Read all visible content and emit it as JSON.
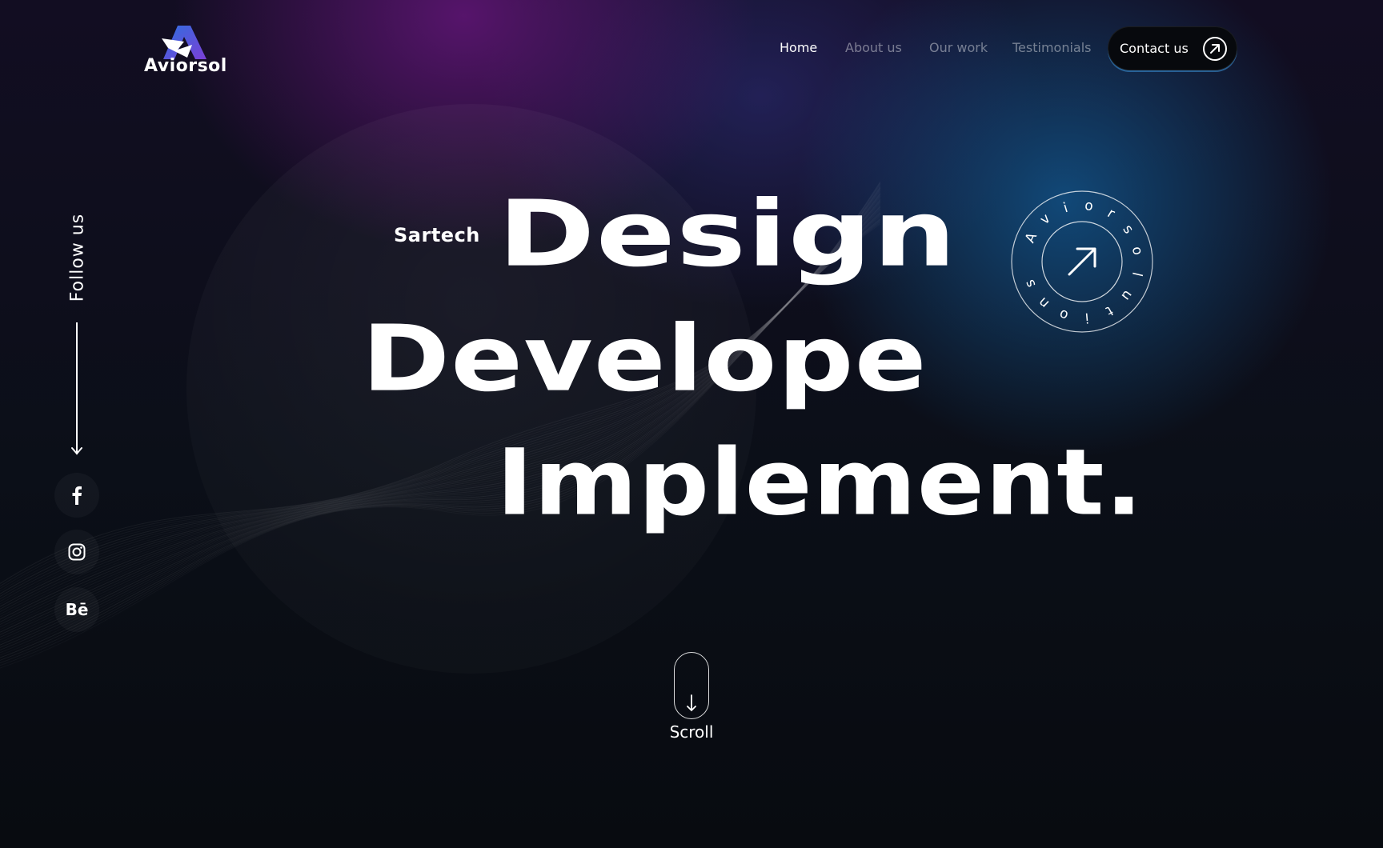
{
  "brand": {
    "name": "Aviorsol"
  },
  "nav": {
    "items": [
      {
        "label": "Home",
        "active": true
      },
      {
        "label": "About us",
        "active": false
      },
      {
        "label": "Our work",
        "active": false
      },
      {
        "label": "Testimonials",
        "active": false
      }
    ],
    "contact_label": "Contact us"
  },
  "social": {
    "follow_label": "Follow us",
    "links": [
      {
        "name": "facebook",
        "icon": "facebook-icon"
      },
      {
        "name": "instagram",
        "icon": "instagram-icon"
      },
      {
        "name": "behance",
        "icon": "behance-icon",
        "glyph": "Bē"
      }
    ]
  },
  "hero": {
    "eyebrow": "Sartech",
    "lines": [
      "Design",
      "Develope",
      "Implement."
    ]
  },
  "badge": {
    "circular_text": "Aviorsolutions",
    "icon": "arrow-up-right-icon"
  },
  "scroll": {
    "label": "Scroll",
    "icon": "arrow-down-icon"
  },
  "colors": {
    "background": "#080b10",
    "purple_glow": "#62167a",
    "blue_glow": "#125c96",
    "text": "#ffffff",
    "nav_inactive": "#8a8f9a"
  }
}
